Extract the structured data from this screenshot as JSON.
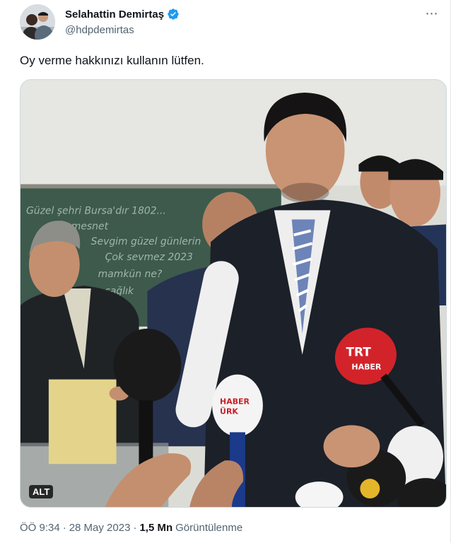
{
  "author": {
    "display_name": "Selahattin Demirtaş",
    "handle": "@hdpdemirtas",
    "verified": true
  },
  "more_icon": "⋯",
  "tweet_text": "Oy verme hakkınızı kullanın lütfen.",
  "media": {
    "alt_badge": "ALT",
    "mic_logos": {
      "trt_line1": "TRT",
      "trt_line2": "HABER",
      "small_mic_line1": "HABER",
      "small_mic_line2": "ÜRK"
    },
    "board_lines": [
      "Güzel şehri Bursa'dır 1802...",
      "Lise mesnet",
      "Sevgim güzel günlerin",
      "Çok sevmez 2023",
      "mamkün ne?",
      "sağlık"
    ]
  },
  "meta": {
    "time": "ÖÖ 9:34",
    "sep1": "·",
    "date": "28 May 2023",
    "sep2": "·",
    "views_count": "1,5 Mn",
    "views_label": "Görüntülenme"
  },
  "colors": {
    "text_primary": "#0f1419",
    "text_secondary": "#536471",
    "verified_blue": "#1d9bf0",
    "border": "#cfd9de",
    "trt_red": "#d2232a"
  }
}
